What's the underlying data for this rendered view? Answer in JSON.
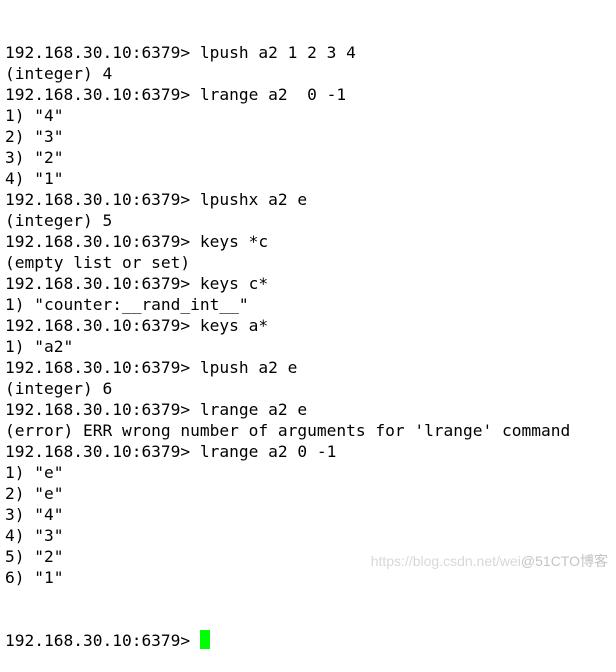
{
  "terminal": {
    "prompt": "192.168.30.10:6379> ",
    "cursor_color": "#00ff00",
    "lines": [
      {
        "type": "command",
        "text": "192.168.30.10:6379> lpush a2 1 2 3 4"
      },
      {
        "type": "output",
        "text": "(integer) 4"
      },
      {
        "type": "command",
        "text": "192.168.30.10:6379> lrange a2  0 -1"
      },
      {
        "type": "output",
        "text": "1) \"4\""
      },
      {
        "type": "output",
        "text": "2) \"3\""
      },
      {
        "type": "output",
        "text": "3) \"2\""
      },
      {
        "type": "output",
        "text": "4) \"1\""
      },
      {
        "type": "command",
        "text": "192.168.30.10:6379> lpushx a2 e"
      },
      {
        "type": "output",
        "text": "(integer) 5"
      },
      {
        "type": "command",
        "text": "192.168.30.10:6379> keys *c"
      },
      {
        "type": "output",
        "text": "(empty list or set)"
      },
      {
        "type": "command",
        "text": "192.168.30.10:6379> keys c*"
      },
      {
        "type": "output",
        "text": "1) \"counter:__rand_int__\""
      },
      {
        "type": "command",
        "text": "192.168.30.10:6379> keys a*"
      },
      {
        "type": "output",
        "text": "1) \"a2\""
      },
      {
        "type": "command",
        "text": "192.168.30.10:6379> lpush a2 e"
      },
      {
        "type": "output",
        "text": "(integer) 6"
      },
      {
        "type": "command",
        "text": "192.168.30.10:6379> lrange a2 e"
      },
      {
        "type": "error",
        "text": "(error) ERR wrong number of arguments for 'lrange' command"
      },
      {
        "type": "command",
        "text": "192.168.30.10:6379> lrange a2 0 -1"
      },
      {
        "type": "output",
        "text": "1) \"e\""
      },
      {
        "type": "output",
        "text": "2) \"e\""
      },
      {
        "type": "output",
        "text": "3) \"4\""
      },
      {
        "type": "output",
        "text": "4) \"3\""
      },
      {
        "type": "output",
        "text": "5) \"2\""
      },
      {
        "type": "output",
        "text": "6) \"1\""
      }
    ]
  },
  "watermark": {
    "url_text": "https://blog.csdn.net/wei",
    "brand_text": "@51CTO博客"
  }
}
